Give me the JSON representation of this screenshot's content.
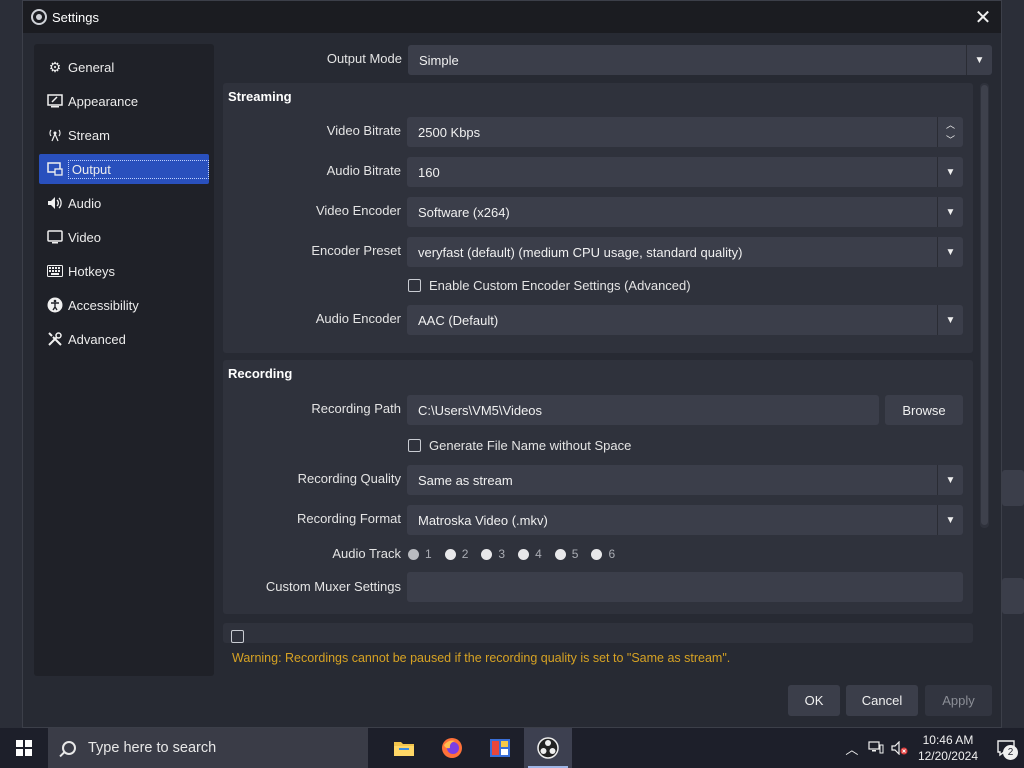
{
  "window": {
    "title": "Settings"
  },
  "sidebar": {
    "items": [
      {
        "label": "General",
        "icon": "gear-icon"
      },
      {
        "label": "Appearance",
        "icon": "appearance-icon"
      },
      {
        "label": "Stream",
        "icon": "antenna-icon"
      },
      {
        "label": "Output",
        "icon": "output-icon",
        "active": true
      },
      {
        "label": "Audio",
        "icon": "speaker-icon"
      },
      {
        "label": "Video",
        "icon": "monitor-icon"
      },
      {
        "label": "Hotkeys",
        "icon": "keyboard-icon"
      },
      {
        "label": "Accessibility",
        "icon": "accessibility-icon"
      },
      {
        "label": "Advanced",
        "icon": "tools-icon"
      }
    ]
  },
  "output_mode": {
    "label": "Output Mode",
    "value": "Simple"
  },
  "streaming": {
    "title": "Streaming",
    "video_bitrate": {
      "label": "Video Bitrate",
      "value": "2500 Kbps"
    },
    "audio_bitrate": {
      "label": "Audio Bitrate",
      "value": "160"
    },
    "video_encoder": {
      "label": "Video Encoder",
      "value": "Software (x264)"
    },
    "encoder_preset": {
      "label": "Encoder Preset",
      "value": "veryfast (default) (medium CPU usage, standard quality)"
    },
    "custom_encoder": {
      "label": "Enable Custom Encoder Settings (Advanced)",
      "checked": false
    },
    "audio_encoder": {
      "label": "Audio Encoder",
      "value": "AAC (Default)"
    }
  },
  "recording": {
    "title": "Recording",
    "path": {
      "label": "Recording Path",
      "value": "C:\\Users\\VM5\\Videos",
      "browse_label": "Browse"
    },
    "no_space": {
      "label": "Generate File Name without Space",
      "checked": false
    },
    "quality": {
      "label": "Recording Quality",
      "value": "Same as stream"
    },
    "format": {
      "label": "Recording Format",
      "value": "Matroska Video (.mkv)"
    },
    "audio_track": {
      "label": "Audio Track",
      "tracks": [
        "1",
        "2",
        "3",
        "4",
        "5",
        "6"
      ],
      "selected": "1"
    },
    "muxer": {
      "label": "Custom Muxer Settings",
      "value": ""
    }
  },
  "warning": "Warning: Recordings cannot be paused if the recording quality is set to \"Same as stream\".",
  "buttons": {
    "ok": "OK",
    "cancel": "Cancel",
    "apply": "Apply"
  },
  "taskbar": {
    "search_placeholder": "Type here to search",
    "time": "10:46 AM",
    "date": "12/20/2024",
    "notification_count": "2"
  },
  "colors": {
    "accent": "#2950bd",
    "warning": "#d6a224",
    "panel": "#2f323c",
    "input": "#3b3e4a"
  }
}
